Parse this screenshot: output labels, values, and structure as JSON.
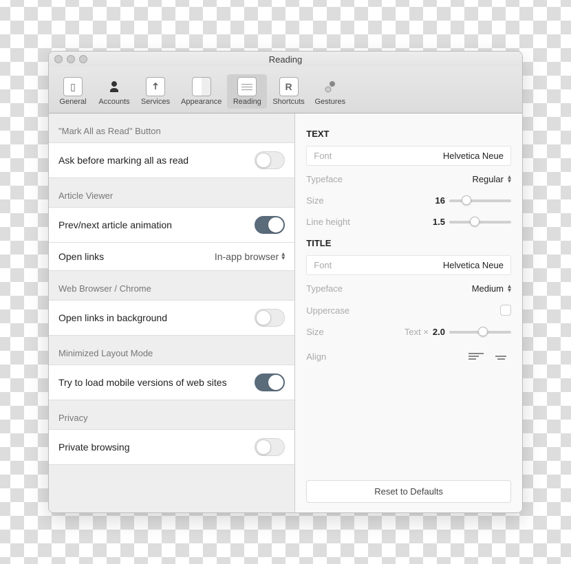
{
  "window": {
    "title": "Reading"
  },
  "toolbar": {
    "general": "General",
    "accounts": "Accounts",
    "services": "Services",
    "appearance": "Appearance",
    "reading": "Reading",
    "shortcuts": "Shortcuts",
    "gestures": "Gestures"
  },
  "left": {
    "mark_header": "\"Mark All as Read\" Button",
    "ask_before": "Ask before marking all as read",
    "article_header": "Article Viewer",
    "prev_next": "Prev/next article animation",
    "open_links": "Open links",
    "open_links_value": "In-app browser",
    "browser_header": "Web Browser / Chrome",
    "open_bg": "Open links in background",
    "min_header": "Minimized Layout Mode",
    "mobile": "Try to load mobile versions of web sites",
    "privacy_header": "Privacy",
    "private": "Private browsing"
  },
  "right": {
    "text_title": "TEXT",
    "title_title": "TITLE",
    "font_label": "Font",
    "font_value": "Helvetica Neue",
    "typeface_label": "Typeface",
    "typeface_text": "Regular",
    "typeface_title": "Medium",
    "size_label": "Size",
    "size_value": "16",
    "lh_label": "Line height",
    "lh_value": "1.5",
    "uppercase_label": "Uppercase",
    "title_size_prefix": "Text ×",
    "title_size_value": "2.0",
    "align_label": "Align",
    "reset": "Reset to Defaults"
  }
}
